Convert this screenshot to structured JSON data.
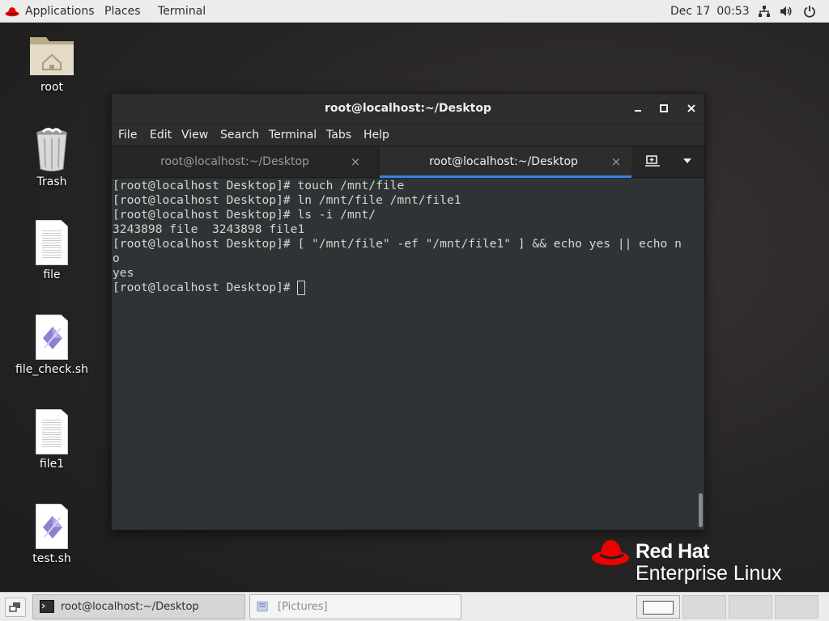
{
  "topbar": {
    "applications": "Applications",
    "places": "Places",
    "terminal": "Terminal",
    "date": "Dec 17",
    "time": "00:53",
    "icons": [
      "network-icon",
      "volume-icon",
      "power-icon"
    ]
  },
  "desktop_icons": [
    {
      "label": "root",
      "icon": "home-folder-icon"
    },
    {
      "label": "Trash",
      "icon": "trash-icon"
    },
    {
      "label": "file",
      "icon": "text-document-icon"
    },
    {
      "label": "file_check.sh",
      "icon": "script-icon"
    },
    {
      "label": "file1",
      "icon": "text-document-icon"
    },
    {
      "label": "test.sh",
      "icon": "script-icon"
    }
  ],
  "window": {
    "title": "root@localhost:~/Desktop",
    "menu": [
      "File",
      "Edit",
      "View",
      "Search",
      "Terminal",
      "Tabs",
      "Help"
    ],
    "tabs": [
      {
        "title": "root@localhost:~/Desktop",
        "active": false
      },
      {
        "title": "root@localhost:~/Desktop",
        "active": true
      }
    ],
    "terminal_lines": [
      "[root@localhost Desktop]# touch /mnt/file",
      "[root@localhost Desktop]# ln /mnt/file /mnt/file1",
      "[root@localhost Desktop]# ls -i /mnt/",
      "3243898 file  3243898 file1",
      "[root@localhost Desktop]# [ \"/mnt/file\" -ef \"/mnt/file1\" ] && echo yes || echo n",
      "o",
      "yes"
    ],
    "prompt": "[root@localhost Desktop]# "
  },
  "brand": {
    "line1": "Red Hat",
    "line2": "Enterprise Linux",
    "color": "#ee0000"
  },
  "taskbar": {
    "tasks": [
      {
        "label": "root@localhost:~/Desktop",
        "icon": "terminal-icon",
        "active": true
      },
      {
        "label": "[Pictures]",
        "icon": "file-manager-icon",
        "active": false
      }
    ],
    "workspaces": 4
  },
  "colors": {
    "accent": "#3584e4",
    "terminal_bg": "#2e3436",
    "terminal_fg": "#d3d7cf"
  }
}
